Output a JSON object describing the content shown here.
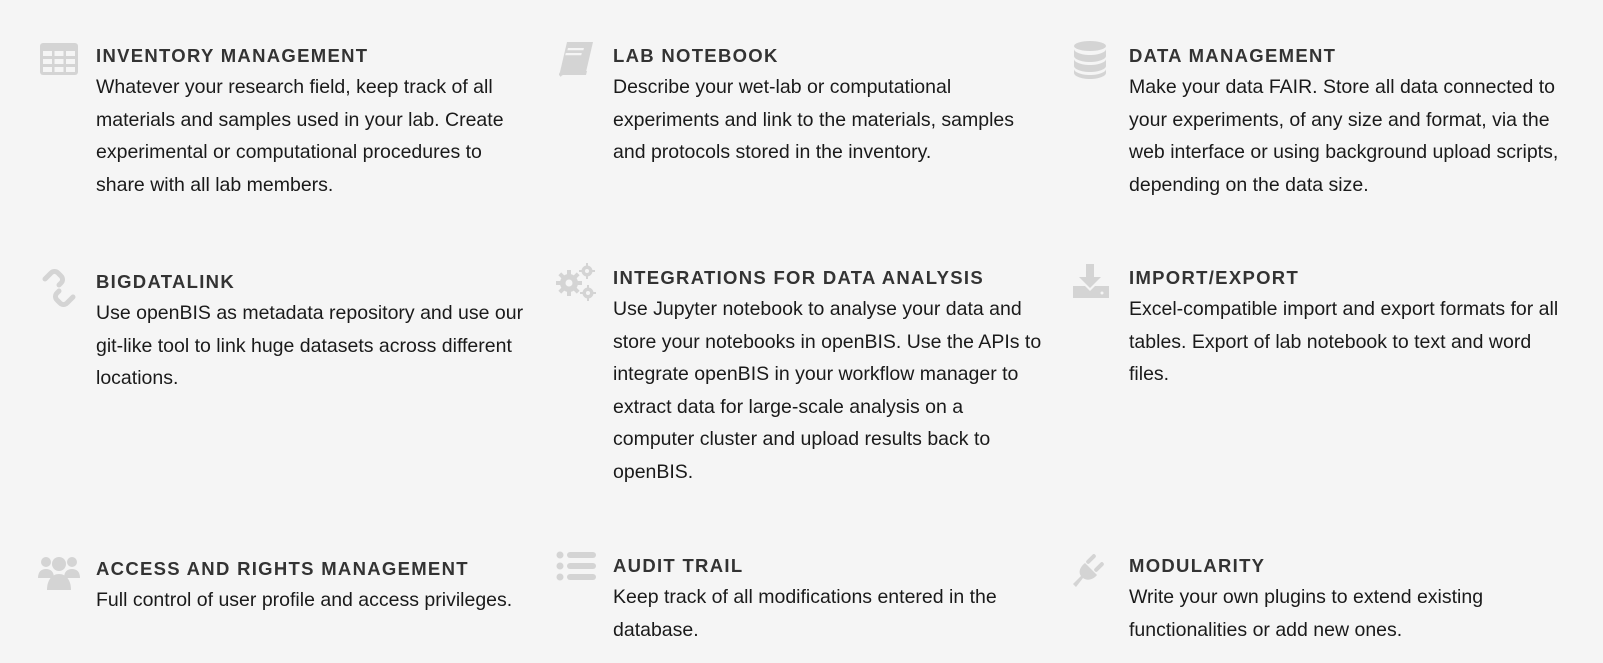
{
  "features": [
    {
      "icon": "table-icon",
      "title": "INVENTORY MANAGEMENT",
      "text": "Whatever your research field, keep track of all materials and samples used in your lab. Create experimental or computational procedures to share with all lab members."
    },
    {
      "icon": "book-icon",
      "title": "LAB NOTEBOOK",
      "text": "Describe your wet-lab or computational experiments and link to the materials, samples and protocols stored in the inventory."
    },
    {
      "icon": "database-icon",
      "title": "DATA MANAGEMENT",
      "text": "Make your data FAIR. Store all data connected to your experiments, of any size and format, via the web interface or using background upload scripts, depending on the data size."
    },
    {
      "icon": "link-icon",
      "title": "BIGDATALINK",
      "text": "Use openBIS as metadata repository and use our git-like tool to link huge datasets across different locations."
    },
    {
      "icon": "gears-icon",
      "title": "INTEGRATIONS FOR DATA ANALYSIS",
      "text": "Use Jupyter notebook to analyse your data and store your notebooks in openBIS. Use the APIs to integrate openBIS in your workflow manager to extract data for large-scale analysis on a computer cluster and upload results back to openBIS."
    },
    {
      "icon": "download-icon",
      "title": "IMPORT/EXPORT",
      "text": "Excel-compatible import and export formats for all tables. Export of lab notebook to text and word files."
    },
    {
      "icon": "users-icon",
      "title": "ACCESS AND RIGHTS MANAGEMENT",
      "text": "Full control of user profile and access privileges."
    },
    {
      "icon": "list-icon",
      "title": "AUDIT TRAIL",
      "text": "Keep track of all modifications entered in the database."
    },
    {
      "icon": "plug-icon",
      "title": "MODULARITY",
      "text": "Write your own plugins to extend existing functionalities or add new ones."
    }
  ],
  "colors": {
    "background": "#f5f5f5",
    "icon": "#d4d4d4",
    "heading": "#333333",
    "text": "#1a1a1a"
  }
}
